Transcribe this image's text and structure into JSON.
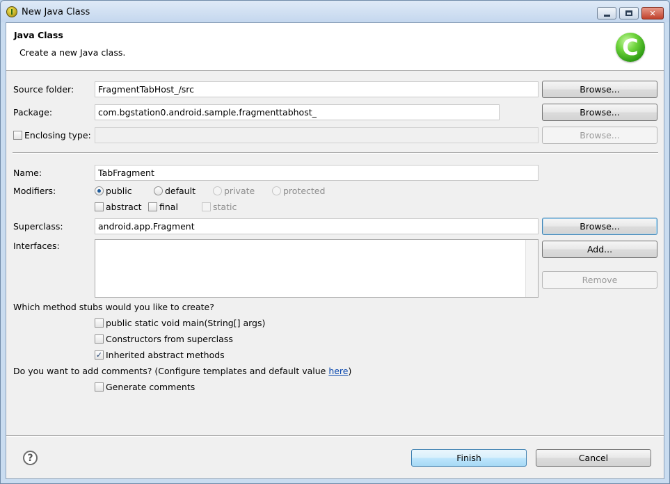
{
  "window": {
    "title": "New Java Class"
  },
  "header": {
    "title": "Java Class",
    "description": "Create a new Java class.",
    "logo_letter": "C"
  },
  "source_folder": {
    "label": "Source folder:",
    "value": "FragmentTabHost_/src",
    "browse": "Browse..."
  },
  "package": {
    "label": "Package:",
    "value": "com.bgstation0.android.sample.fragmenttabhost_",
    "browse": "Browse..."
  },
  "enclosing": {
    "label": "Enclosing type:",
    "value": "",
    "checked": false,
    "browse": "Browse..."
  },
  "name": {
    "label": "Name:",
    "value": "TabFragment"
  },
  "modifiers": {
    "label": "Modifiers:",
    "radios": [
      {
        "label": "public",
        "checked": true,
        "enabled": true
      },
      {
        "label": "default",
        "checked": false,
        "enabled": true
      },
      {
        "label": "private",
        "checked": false,
        "enabled": false
      },
      {
        "label": "protected",
        "checked": false,
        "enabled": false
      }
    ],
    "checks": [
      {
        "label": "abstract",
        "checked": false,
        "enabled": true
      },
      {
        "label": "final",
        "checked": false,
        "enabled": true
      },
      {
        "label": "static",
        "checked": false,
        "enabled": false
      }
    ]
  },
  "superclass": {
    "label": "Superclass:",
    "value": "android.app.Fragment",
    "browse": "Browse..."
  },
  "interfaces": {
    "label": "Interfaces:",
    "add": "Add...",
    "remove": "Remove",
    "items": []
  },
  "stubs": {
    "question": "Which method stubs would you like to create?",
    "options": [
      {
        "label": "public static void main(String[] args)",
        "checked": false
      },
      {
        "label": "Constructors from superclass",
        "checked": false
      },
      {
        "label": "Inherited abstract methods",
        "checked": true
      }
    ]
  },
  "comments": {
    "question_prefix": "Do you want to add comments? (Configure templates and default value ",
    "link": "here",
    "question_suffix": ")",
    "option": {
      "label": "Generate comments",
      "checked": false
    }
  },
  "footer": {
    "help": "?",
    "finish": "Finish",
    "cancel": "Cancel"
  },
  "colors": {
    "link": "#0645ad",
    "accent": "#3c7fb1",
    "logo": "#2c9a12"
  }
}
